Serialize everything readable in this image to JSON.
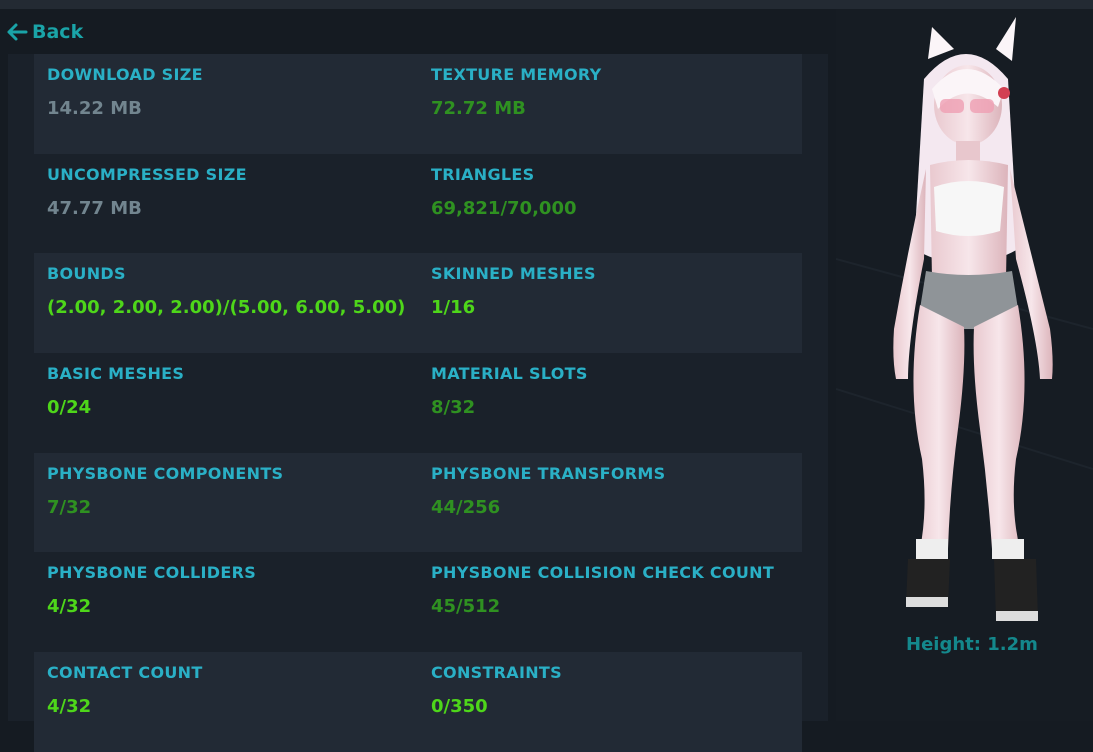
{
  "nav": {
    "back_label": "Back"
  },
  "colors": {
    "label": "#2ab0c6",
    "value_gray": "#72858f",
    "value_green": "#2f9121",
    "value_lime": "#4ed61a"
  },
  "stats": [
    [
      {
        "label": "DOWNLOAD SIZE",
        "value": "14.22 MB",
        "tone": "gray"
      },
      {
        "label": "TEXTURE MEMORY",
        "value": "72.72 MB",
        "tone": "green"
      }
    ],
    [
      {
        "label": "UNCOMPRESSED SIZE",
        "value": "47.77 MB",
        "tone": "gray"
      },
      {
        "label": "TRIANGLES",
        "value": "69,821/70,000",
        "tone": "green"
      }
    ],
    [
      {
        "label": "BOUNDS",
        "value": "(2.00, 2.00, 2.00)/(5.00, 6.00, 5.00)",
        "tone": "lime"
      },
      {
        "label": "SKINNED MESHES",
        "value": "1/16",
        "tone": "lime"
      }
    ],
    [
      {
        "label": "BASIC MESHES",
        "value": "0/24",
        "tone": "lime"
      },
      {
        "label": "MATERIAL SLOTS",
        "value": "8/32",
        "tone": "green"
      }
    ],
    [
      {
        "label": "PHYSBONE COMPONENTS",
        "value": "7/32",
        "tone": "green"
      },
      {
        "label": "PHYSBONE TRANSFORMS",
        "value": "44/256",
        "tone": "green"
      }
    ],
    [
      {
        "label": "PHYSBONE COLLIDERS",
        "value": "4/32",
        "tone": "lime"
      },
      {
        "label": "PHYSBONE COLLISION CHECK COUNT",
        "value": "45/512",
        "tone": "green"
      }
    ],
    [
      {
        "label": "CONTACT COUNT",
        "value": "4/32",
        "tone": "lime"
      },
      {
        "label": "CONSTRAINTS",
        "value": "0/350",
        "tone": "lime"
      }
    ]
  ],
  "avatar": {
    "height_label": "Height: 1.2m"
  }
}
